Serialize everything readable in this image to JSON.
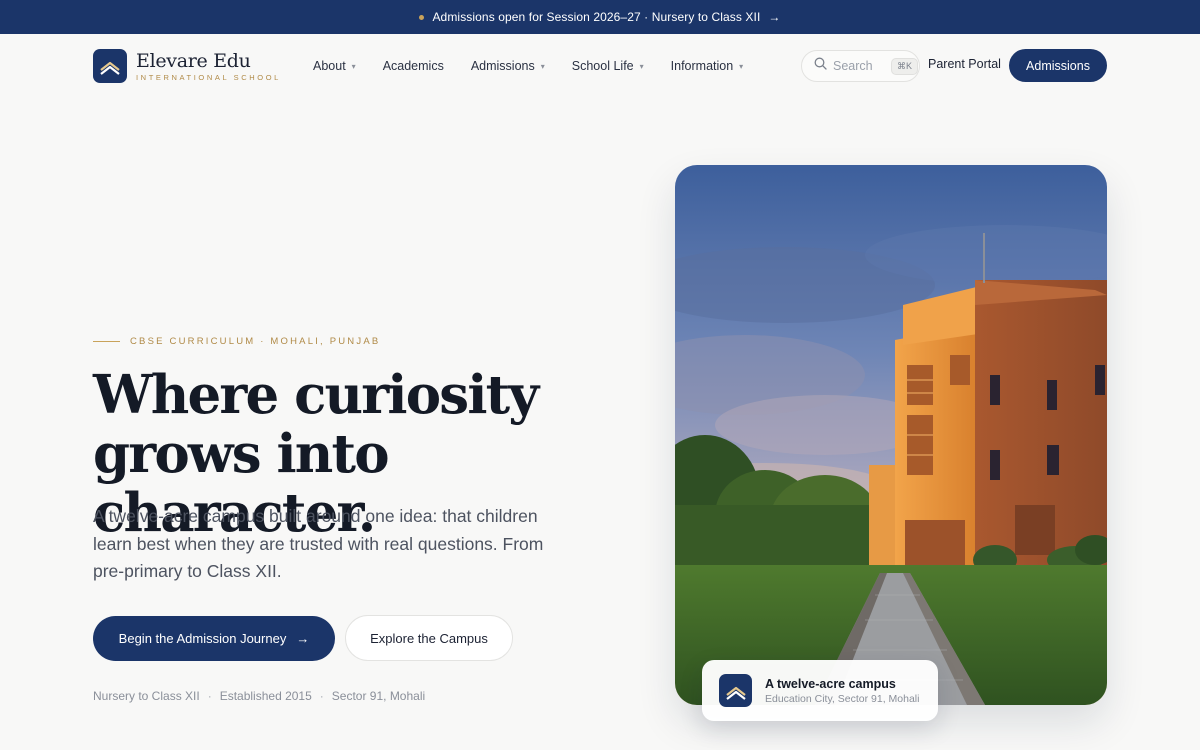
{
  "announcement": {
    "text": "Admissions open for Session 2026–27 · Nursery to Class XII",
    "arrow": "→"
  },
  "brand": {
    "name": "Elevare Edu",
    "tagline": "INTERNATIONAL SCHOOL",
    "logo_icon": "chevron-crest-icon"
  },
  "nav": {
    "items": [
      {
        "label": "About",
        "has_dropdown": true
      },
      {
        "label": "Academics",
        "has_dropdown": false
      },
      {
        "label": "Admissions",
        "has_dropdown": true
      },
      {
        "label": "School Life",
        "has_dropdown": true
      },
      {
        "label": "Information",
        "has_dropdown": true
      }
    ],
    "chevron": "⌄"
  },
  "search": {
    "placeholder": "Search",
    "shortcut": "⌘K"
  },
  "header_actions": {
    "portal_label": "Parent Portal",
    "admissions_label": "Admissions"
  },
  "hero": {
    "eyebrow": "CBSE CURRICULUM · MOHALI, PUNJAB",
    "title_line1": "Where curiosity",
    "title_line2": "grows into character.",
    "description": "A twelve-acre campus built around one idea: that children learn best when they are trusted with real questions. From pre-primary to Class XII.",
    "cta_primary": "Begin the Admission Journey",
    "cta_primary_arrow": "→",
    "cta_secondary": "Explore the Campus",
    "facts": [
      "Nursery to Class XII",
      "Established 2015",
      "Sector 91, Mohali"
    ],
    "fact_separator": "·"
  },
  "photo_caption": {
    "title": "A twelve-acre campus",
    "subtitle": "Education City, Sector 91, Mohali"
  },
  "colors": {
    "navy": "#1b3569",
    "gold": "#b08a47",
    "background": "#f8f8f7"
  }
}
